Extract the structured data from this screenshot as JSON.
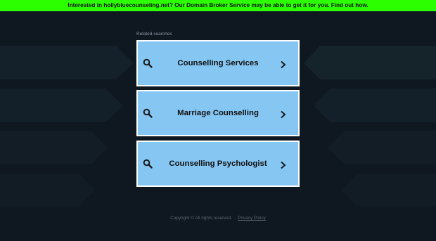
{
  "banner": {
    "text": "Interested in hollybluecounseling.net? Our Domain Broker Service may be able to get it for you. Find out how."
  },
  "related": {
    "label": "Related searches",
    "items": [
      {
        "label": "Counselling Services"
      },
      {
        "label": "Marriage Counselling"
      },
      {
        "label": "Counselling Psychologist"
      }
    ]
  },
  "footer": {
    "copyright": "Copyright ©  All rights reserved.",
    "privacy": "Privacy Policy"
  },
  "colors": {
    "banner": "#2bff00",
    "background": "#0f1721",
    "result_box": "#86c6f3",
    "result_border": "#ffffff"
  },
  "icons": {
    "result_left": "search-icon",
    "result_right": "chevron-right-icon"
  }
}
